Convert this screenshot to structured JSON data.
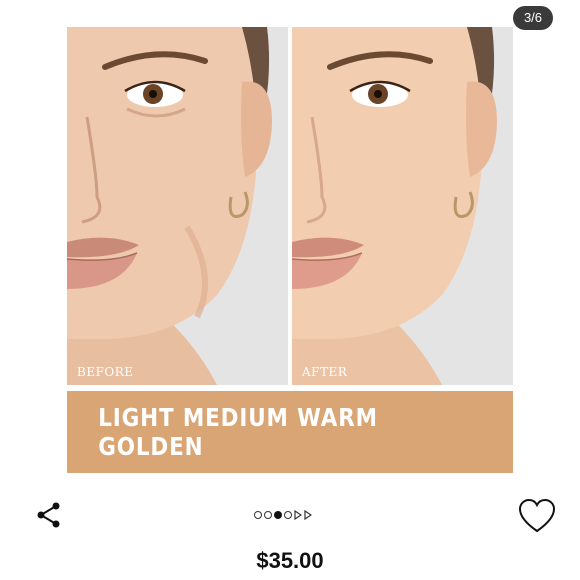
{
  "gallery": {
    "counter": "3/6",
    "before_label": "BEFORE",
    "after_label": "AFTER",
    "shade_name": "LIGHT MEDIUM WARM GOLDEN",
    "pager": {
      "total": 6,
      "active_index": 2
    }
  },
  "product": {
    "price": "$35.00"
  },
  "icons": {
    "share": "share-icon",
    "favorite": "heart-outline-icon"
  },
  "colors": {
    "banner": "#d9a574",
    "background": "#ffffff",
    "counter_bg": "#3a3a3a"
  }
}
